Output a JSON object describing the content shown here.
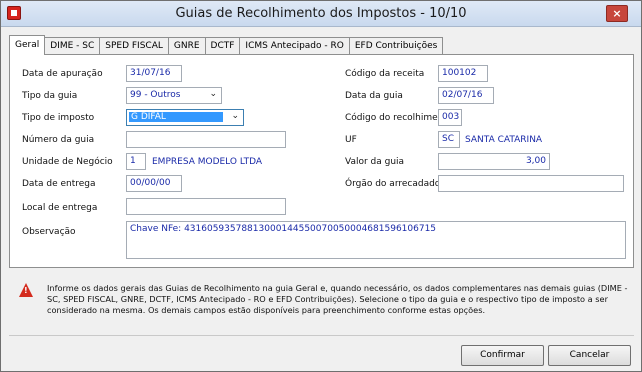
{
  "window": {
    "title": "Guias de Recolhimento dos Impostos - 10/10",
    "close_glyph": "×",
    "app_icon": "app-icon"
  },
  "tabs": [
    {
      "label": "Geral",
      "active": true
    },
    {
      "label": "DIME - SC"
    },
    {
      "label": "SPED FISCAL"
    },
    {
      "label": "GNRE"
    },
    {
      "label": "DCTF"
    },
    {
      "label": "ICMS Antecipado - RO"
    },
    {
      "label": "EFD Contribuições"
    }
  ],
  "form": {
    "data_apuracao": {
      "label": "Data de apuração",
      "value": "31/07/16"
    },
    "tipo_guia": {
      "label": "Tipo da guia",
      "value": "99 - Outros"
    },
    "tipo_imposto": {
      "label": "Tipo de imposto",
      "value": "G DIFAL"
    },
    "numero_guia": {
      "label": "Número da guia",
      "value": ""
    },
    "unidade_negocio": {
      "label": "Unidade de Negócio",
      "code": "1",
      "name": "EMPRESA MODELO LTDA"
    },
    "data_entrega": {
      "label": "Data de entrega",
      "value": "00/00/00"
    },
    "local_entrega": {
      "label": "Local de entrega",
      "value": ""
    },
    "codigo_receita": {
      "label": "Código da receita",
      "value": "100102"
    },
    "data_guia": {
      "label": "Data da guia",
      "value": "02/07/16"
    },
    "codigo_recolhimento": {
      "label": "Código do recolhimento",
      "value": "003"
    },
    "uf": {
      "label": "UF",
      "code": "SC",
      "name": "SANTA CATARINA"
    },
    "valor_guia": {
      "label": "Valor da guia",
      "value": "3,00"
    },
    "orgao_arrecadador": {
      "label": "Órgão do arrecadador",
      "value": ""
    },
    "observacao": {
      "label": "Observação",
      "value": "Chave NFe: 43160593578813000144550070050004681596106715"
    }
  },
  "info": {
    "icon": "warning-icon",
    "text": "Informe os dados gerais das Guias de Recolhimento na guia Geral e, quando necessário, os dados complementares nas demais guias (DIME - SC, SPED FISCAL, GNRE, DCTF, ICMS Antecipado - RO e EFD Contribuições). Selecione o tipo da guia e o respectivo tipo de imposto a ser considerado na mesma. Os demais campos estão disponíveis para preenchimento conforme estas opções."
  },
  "buttons": {
    "confirm": "Confirmar",
    "cancel": "Cancelar"
  },
  "colors": {
    "value_text": "#1a2aa8",
    "selection": "#3399ff",
    "warning": "#d42b1e"
  }
}
